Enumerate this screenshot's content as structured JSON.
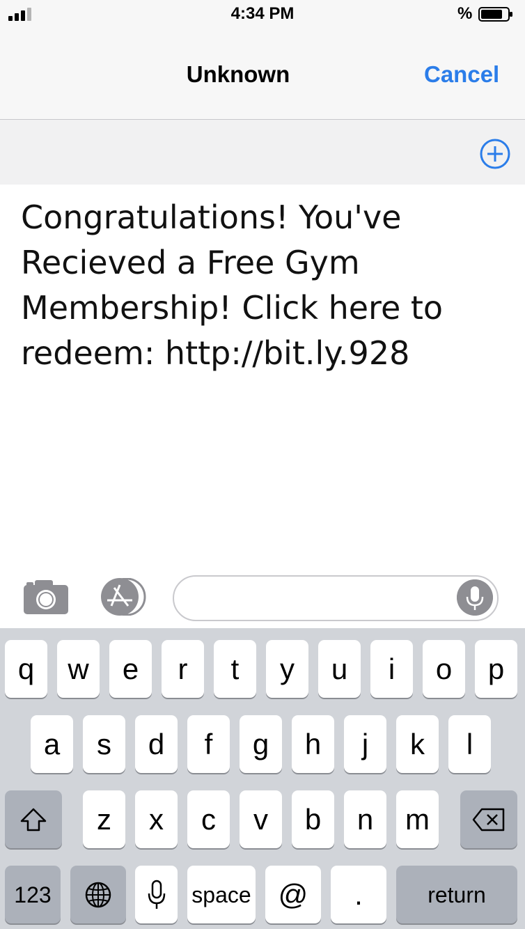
{
  "status_bar": {
    "time": "4:34 PM",
    "battery_percent": "%",
    "battery_level": 0.8,
    "signal_bars": 3,
    "signal_bars_total": 4,
    "icons": [
      "signal-icon",
      "battery-icon"
    ]
  },
  "nav": {
    "title": "Unknown",
    "cancel_label": "Cancel"
  },
  "recipient": {
    "add_icon": "plus-circle-icon"
  },
  "message": {
    "text": "Congratulations! You've Recieved a Free Gym Membership! Click here to redeem: http://bit.ly.928"
  },
  "compose": {
    "input_value": "",
    "input_placeholder": "",
    "icons": [
      "camera-icon",
      "app-store-icon",
      "microphone-icon"
    ]
  },
  "keyboard": {
    "row1": [
      "q",
      "w",
      "e",
      "r",
      "t",
      "y",
      "u",
      "i",
      "o",
      "p"
    ],
    "row2": [
      "a",
      "s",
      "d",
      "f",
      "g",
      "h",
      "j",
      "k",
      "l"
    ],
    "row3": [
      "z",
      "x",
      "c",
      "v",
      "b",
      "n",
      "m"
    ],
    "numbers_label": "123",
    "space_label": "space",
    "at_label": "@",
    "dot_label": ".",
    "return_label": "return",
    "icons": [
      "shift-icon",
      "delete-icon",
      "globe-icon",
      "microphone-icon"
    ]
  },
  "colors": {
    "accent": "#2b7de9",
    "keyboard_bg": "#d1d4d9",
    "key_dark": "#acb1ba",
    "key_light": "#ffffff"
  }
}
